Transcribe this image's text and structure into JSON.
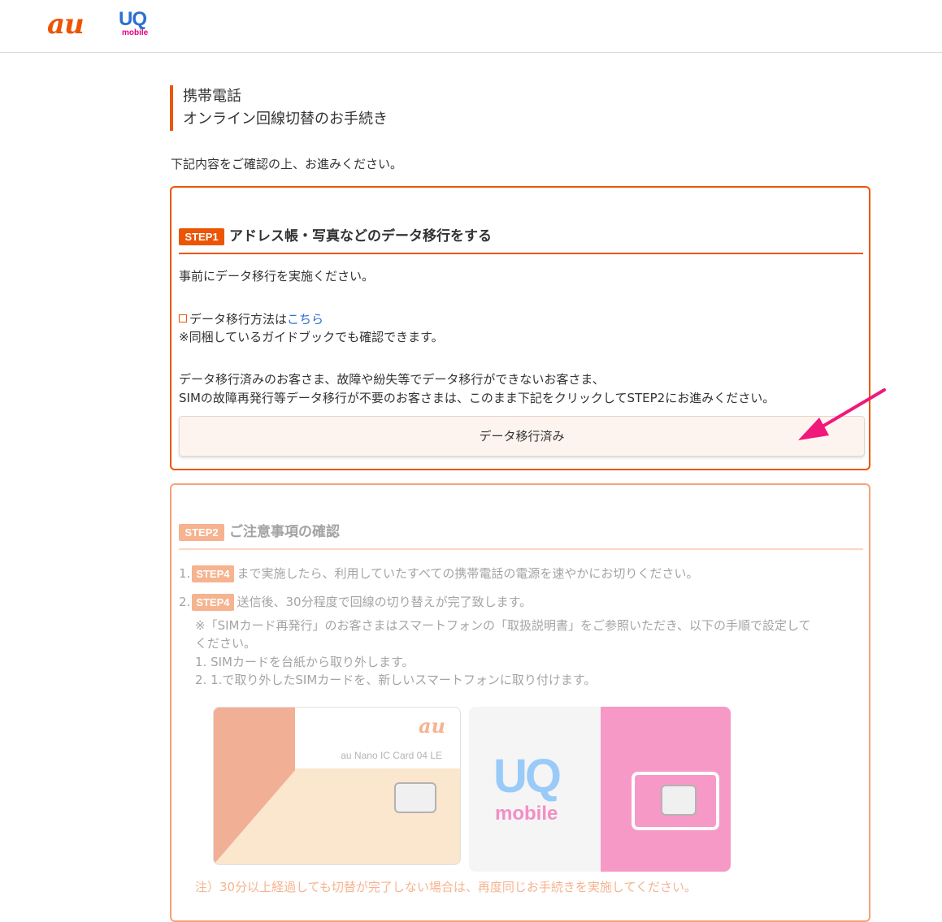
{
  "header": {
    "au_logo": "au",
    "uq_logo": "UQ",
    "uq_logo_sub": "mobile"
  },
  "page": {
    "title_line1": "携帯電話",
    "title_line2": "オンライン回線切替のお手続き",
    "intro": "下記内容をご確認の上、お進みください。"
  },
  "step1": {
    "badge": "STEP1",
    "title": "アドレス帳・写真などのデータ移行をする",
    "p1": "事前にデータ移行を実施ください。",
    "link_prefix": "データ移行方法は",
    "link_text": "こちら",
    "p2": "※同梱しているガイドブックでも確認できます。",
    "p3": "データ移行済みのお客さま、故障や紛失等でデータ移行ができないお客さま、",
    "p4": "SIMの故障再発行等データ移行が不要のお客さまは、このまま下記をクリックしてSTEP2にお進みください。",
    "button": "データ移行済み"
  },
  "step2": {
    "badge": "STEP2",
    "title": "ご注意事項の確認",
    "item1_num": "1.",
    "item1_badge": "STEP4",
    "item1_text": "まで実施したら、利用していたすべての携帯電話の電源を速やかにお切りください。",
    "item2_num": "2.",
    "item2_badge": "STEP4",
    "item2_text": "送信後、30分程度で回線の切り替えが完了致します。",
    "note1": "※「SIMカード再発行」のお客さまはスマートフォンの「取扱説明書」をご参照いただき、以下の手順で設定して",
    "note1b": "ください。",
    "note2": "1. SIMカードを台紙から取り外します。",
    "note3": "2. 1.で取り外したSIMカードを、新しいスマートフォンに取り付けます。",
    "sim1_logo": "au",
    "sim1_caption": "au Nano IC Card 04 LE",
    "sim2_logo": "UQ",
    "sim2_logo_sub": "mobile",
    "warning": "注）30分以上経過しても切替が完了しない場合は、再度同じお手続きを実施してください。"
  }
}
